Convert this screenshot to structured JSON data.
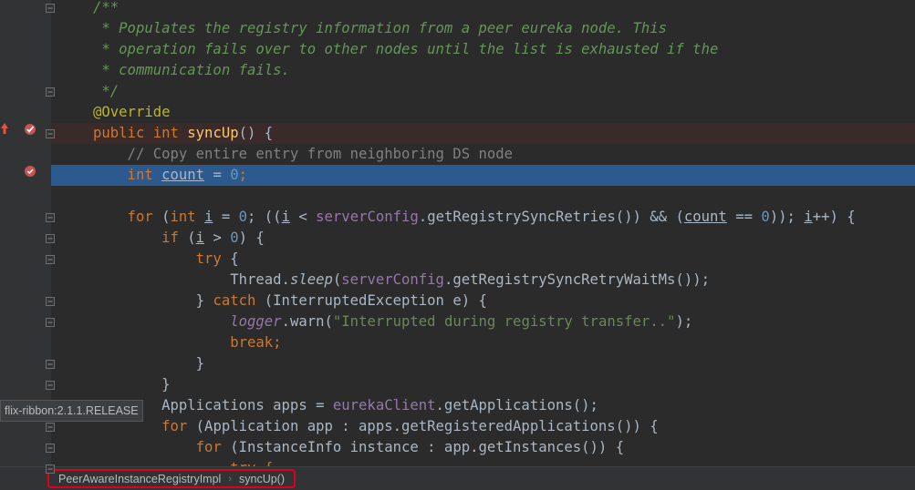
{
  "editor": {
    "lines": [
      [
        {
          "t": "/**",
          "c": "c-doc"
        }
      ],
      [
        {
          "t": " * Populates the registry information from a peer eureka node. This",
          "c": "c-doc"
        }
      ],
      [
        {
          "t": " * operation fails over to other nodes until the list is exhausted if the",
          "c": "c-doc"
        }
      ],
      [
        {
          "t": " * communication fails.",
          "c": "c-doc"
        }
      ],
      [
        {
          "t": " */",
          "c": "c-doc"
        }
      ],
      [
        {
          "t": "@Override",
          "c": "c-ann"
        }
      ],
      [
        {
          "t": "public ",
          "c": "c-kw"
        },
        {
          "t": "int ",
          "c": "c-kw"
        },
        {
          "t": "syncUp",
          "c": "c-fn"
        },
        {
          "t": "() {",
          "c": ""
        }
      ],
      [
        {
          "t": "    // Copy entire entry from neighboring DS node",
          "c": "c-comment"
        }
      ],
      [
        {
          "t": "    int ",
          "c": "c-kw"
        },
        {
          "t": "count",
          "c": "c-var"
        },
        {
          "t": " = ",
          "c": ""
        },
        {
          "t": "0",
          "c": "c-num"
        },
        {
          "t": ";",
          "c": "c-kw"
        }
      ],
      [],
      [
        {
          "t": "    for ",
          "c": "c-kw"
        },
        {
          "t": "(",
          "c": ""
        },
        {
          "t": "int ",
          "c": "c-kw"
        },
        {
          "t": "i",
          "c": "c-var"
        },
        {
          "t": " = ",
          "c": ""
        },
        {
          "t": "0",
          "c": "c-num"
        },
        {
          "t": "; ((",
          "c": ""
        },
        {
          "t": "i",
          "c": "c-var"
        },
        {
          "t": " < ",
          "c": ""
        },
        {
          "t": "serverConfig",
          "c": "c-field"
        },
        {
          "t": ".getRegistrySyncRetries()) && (",
          "c": ""
        },
        {
          "t": "count",
          "c": "c-var"
        },
        {
          "t": " == ",
          "c": ""
        },
        {
          "t": "0",
          "c": "c-num"
        },
        {
          "t": ")); ",
          "c": ""
        },
        {
          "t": "i",
          "c": "c-var"
        },
        {
          "t": "++) {",
          "c": ""
        }
      ],
      [
        {
          "t": "        if ",
          "c": "c-kw"
        },
        {
          "t": "(",
          "c": ""
        },
        {
          "t": "i",
          "c": "c-var"
        },
        {
          "t": " > ",
          "c": ""
        },
        {
          "t": "0",
          "c": "c-num"
        },
        {
          "t": ") {",
          "c": ""
        }
      ],
      [
        {
          "t": "            try ",
          "c": "c-kw"
        },
        {
          "t": "{",
          "c": ""
        }
      ],
      [
        {
          "t": "                Thread.",
          "c": ""
        },
        {
          "t": "sleep",
          "c": "c-italic"
        },
        {
          "t": "(",
          "c": ""
        },
        {
          "t": "serverConfig",
          "c": "c-field"
        },
        {
          "t": ".getRegistrySyncRetryWaitMs());",
          "c": ""
        }
      ],
      [
        {
          "t": "            } ",
          "c": ""
        },
        {
          "t": "catch ",
          "c": "c-kw"
        },
        {
          "t": "(InterruptedException e) {",
          "c": ""
        }
      ],
      [
        {
          "t": "                ",
          "c": ""
        },
        {
          "t": "logger",
          "c": "c-static"
        },
        {
          "t": ".warn(",
          "c": ""
        },
        {
          "t": "\"Interrupted during registry transfer..\"",
          "c": "c-str"
        },
        {
          "t": ");",
          "c": ""
        }
      ],
      [
        {
          "t": "                break",
          "c": "c-kw"
        },
        {
          "t": ";",
          "c": "c-kw"
        }
      ],
      [
        {
          "t": "            }",
          "c": ""
        }
      ],
      [
        {
          "t": "        }",
          "c": ""
        }
      ],
      [
        {
          "t": "        Applications apps = ",
          "c": ""
        },
        {
          "t": "eurekaClient",
          "c": "c-field"
        },
        {
          "t": ".getApplications();",
          "c": ""
        }
      ],
      [
        {
          "t": "        for ",
          "c": "c-kw"
        },
        {
          "t": "(Application app : apps.getRegisteredApplications()) {",
          "c": ""
        }
      ],
      [
        {
          "t": "            for ",
          "c": "c-kw"
        },
        {
          "t": "(InstanceInfo instance : app.getInstances()) {",
          "c": ""
        }
      ],
      [
        {
          "t": "                try {",
          "c": "c-kw"
        }
      ]
    ]
  },
  "tooltip": {
    "text": "flix-ribbon:2.1.1.RELEASE"
  },
  "breadcrumb": {
    "class_name": "PeerAwareInstanceRegistryImpl",
    "separator": "›",
    "method_name": "syncUp()"
  },
  "gutter_icons": {
    "override_icon": "override-up-arrow-icon",
    "breakpoint_icon": "breakpoint-icon",
    "fold_icon": "fold-marker-icon"
  },
  "colors": {
    "highlight_blue": "#2d5a8e",
    "highlight_red": "#3a2a2a",
    "breadcrumb_border": "#e0001b"
  }
}
